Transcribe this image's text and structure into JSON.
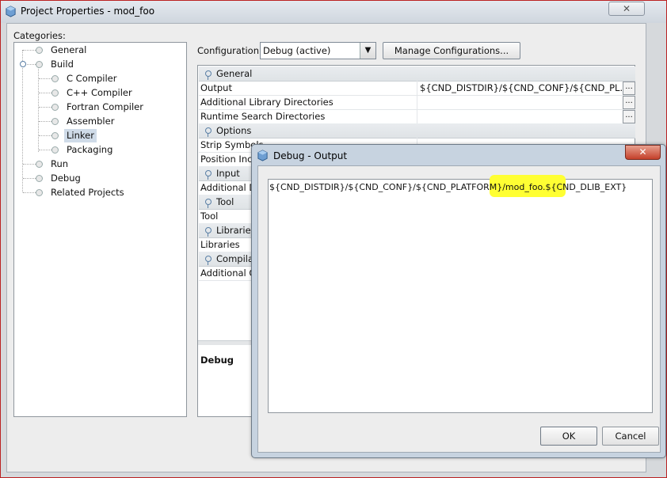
{
  "window": {
    "title": "Project Properties - mod_foo",
    "close_glyph": "✕"
  },
  "categories": {
    "label": "Categories:",
    "items": [
      {
        "label": "General",
        "depth": 0
      },
      {
        "label": "Build",
        "depth": 0
      },
      {
        "label": "C Compiler",
        "depth": 1
      },
      {
        "label": "C++ Compiler",
        "depth": 1
      },
      {
        "label": "Fortran Compiler",
        "depth": 1
      },
      {
        "label": "Assembler",
        "depth": 1
      },
      {
        "label": "Linker",
        "depth": 1,
        "selected": true
      },
      {
        "label": "Packaging",
        "depth": 1
      },
      {
        "label": "Run",
        "depth": 0
      },
      {
        "label": "Debug",
        "depth": 0
      },
      {
        "label": "Related Projects",
        "depth": 0
      }
    ]
  },
  "configuration": {
    "label": "Configuration:",
    "selected": "Debug (active)",
    "manage_button": "Manage Configurations..."
  },
  "properties": {
    "sections": [
      {
        "title": "General"
      },
      {
        "title": "Options"
      },
      {
        "title": "Input"
      },
      {
        "title": "Tool"
      },
      {
        "title": "Librarie"
      },
      {
        "title": "Compila"
      }
    ],
    "rows": [
      {
        "key": "Output",
        "value": "${CND_DISTDIR}/${CND_CONF}/${CND_PL...",
        "has_button": true
      },
      {
        "key": "Additional Library Directories",
        "value": "",
        "has_button": true
      },
      {
        "key": "Runtime Search Directories",
        "value": "",
        "has_button": true
      },
      {
        "key": "Strip Symbols",
        "value": ""
      },
      {
        "key": "Position Inc",
        "value": ""
      },
      {
        "key": "Additional D",
        "value": ""
      },
      {
        "key": "Tool",
        "value": ""
      },
      {
        "key": "Libraries",
        "value": ""
      },
      {
        "key": "Additional O",
        "value": ""
      }
    ],
    "description_title": "Debug",
    "button_glyph": "..."
  },
  "dialog": {
    "title": "Debug - Output",
    "close_glyph": "✕",
    "text": "${CND_DISTDIR}/${CND_CONF}/${CND_PLATFORM}/mod_foo.${CND_DLIB_EXT}",
    "ok": "OK",
    "cancel": "Cancel",
    "highlight_color": "#ffff33"
  },
  "colors": {
    "selection": "#cfdbe8",
    "close_red": "#c4402a"
  }
}
